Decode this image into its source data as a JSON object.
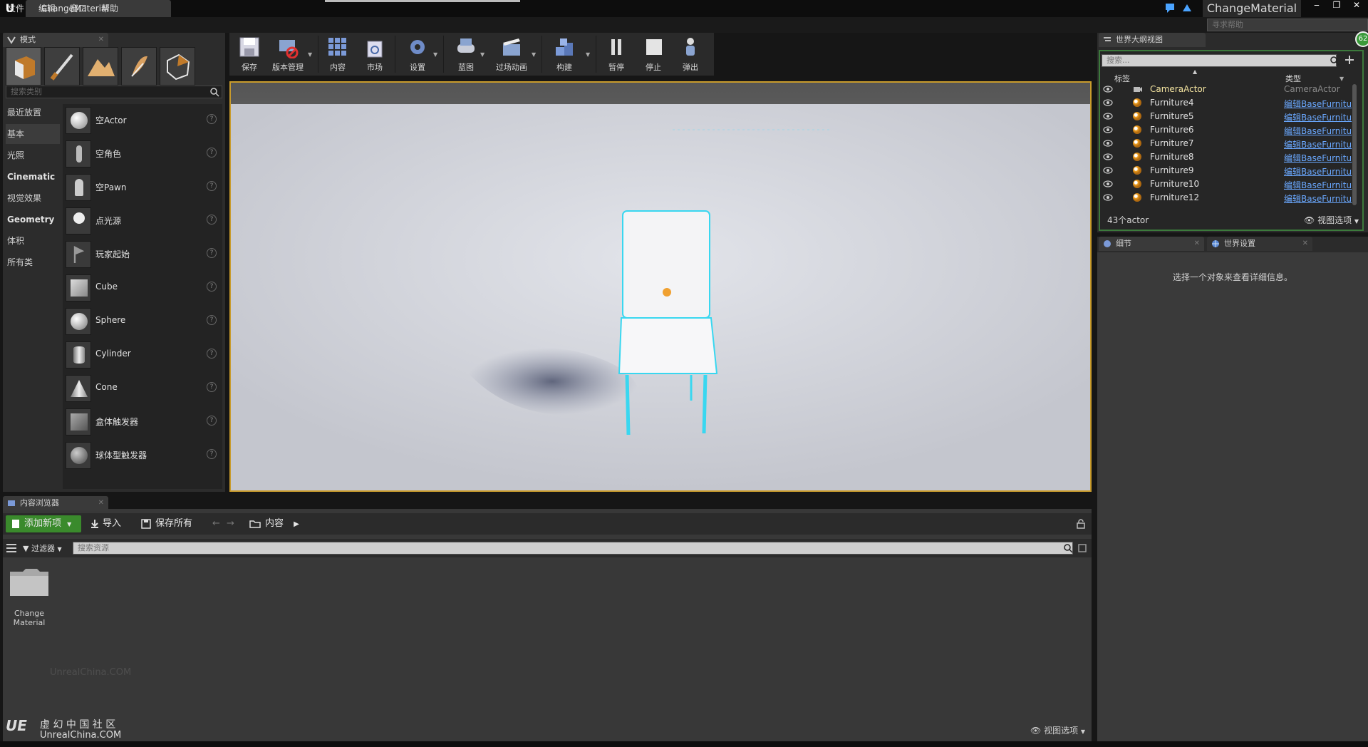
{
  "window": {
    "doc_tab": "ChangeMaterial",
    "app_title": "ChangeMaterial",
    "controls": [
      "‒",
      "❐",
      "✕"
    ]
  },
  "menu": {
    "items": [
      "文件",
      "编辑",
      "窗口",
      "帮助"
    ],
    "help_search_placeholder": "寻求帮助"
  },
  "modes": {
    "tab_label": "模式",
    "search_placeholder": "搜索类别",
    "categories": [
      "最近放置",
      "基本",
      "光照",
      "Cinematic",
      "视觉效果",
      "Geometry",
      "体积",
      "所有类"
    ],
    "active_category": "基本",
    "items": [
      "空Actor",
      "空角色",
      "空Pawn",
      "点光源",
      "玩家起始",
      "Cube",
      "Sphere",
      "Cylinder",
      "Cone",
      "盒体触发器",
      "球体型触发器"
    ]
  },
  "toolbar": {
    "buttons": [
      "保存",
      "版本管理",
      "内容",
      "市场",
      "设置",
      "蓝图",
      "过场动画",
      "构建",
      "暂停",
      "停止",
      "弹出"
    ]
  },
  "content_browser": {
    "tab_label": "内容浏览器",
    "add_new": "添加新项",
    "import": "导入",
    "save_all": "保存所有",
    "path": "内容",
    "filter": "过滤器",
    "search_placeholder": "搜索资源",
    "folder_name": "Change Material",
    "view_options": "视图选项"
  },
  "outliner": {
    "tab_label": "世界大纲视图",
    "search_placeholder": "搜索...",
    "col_label": "标签",
    "col_type": "类型",
    "rows": [
      {
        "name": "CameraActor",
        "type": "CameraActor"
      },
      {
        "name": "Furniture4",
        "type": "编辑BaseFurnitu"
      },
      {
        "name": "Furniture5",
        "type": "编辑BaseFurnitu"
      },
      {
        "name": "Furniture6",
        "type": "编辑BaseFurnitu"
      },
      {
        "name": "Furniture7",
        "type": "编辑BaseFurnitu"
      },
      {
        "name": "Furniture8",
        "type": "编辑BaseFurnitu"
      },
      {
        "name": "Furniture9",
        "type": "编辑BaseFurnitu"
      },
      {
        "name": "Furniture10",
        "type": "编辑BaseFurnitu"
      },
      {
        "name": "Furniture12",
        "type": "编辑BaseFurnitu"
      }
    ],
    "actor_count": "43个actor",
    "view_options": "视图选项",
    "fps_badge": "62"
  },
  "details": {
    "tab_label": "细节",
    "world_settings_tab": "世界设置",
    "empty_message": "选择一个对象来查看详细信息。"
  },
  "watermark": {
    "site": "UnrealChina.COM",
    "community": "虚 幻 中 国 社 区",
    "logo": "UE"
  },
  "colors": {
    "accent": "#c89b2c",
    "add_new_green": "#3a8a2c",
    "link_blue": "#6aa8ff",
    "selection_cyan": "#39d7f0"
  }
}
